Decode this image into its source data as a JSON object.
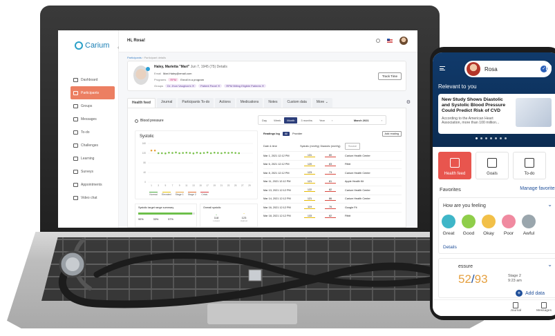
{
  "web": {
    "brand": "Carium",
    "greeting": "Hi, Rosa!",
    "nav": [
      "Dashboard",
      "Participants",
      "Groups",
      "Messages",
      "To-do",
      "Challenges",
      "Learning",
      "Surveys",
      "Appointments",
      "Video chat"
    ],
    "active_nav": "Participants",
    "breadcrumbs": [
      "Participants",
      "Participant details"
    ],
    "profile": {
      "name": "Haley, Marietta \"Mari\"",
      "dob": "Jun 7, 1945 (75)",
      "details_link": "Details",
      "email_label": "Email",
      "email": "Mari.Haley@email.com",
      "programs_label": "Programs",
      "program_chip": "RPM",
      "program_status": "Enroll in a program",
      "groups_label": "Groups",
      "group_chips": [
        "Dr. Jhon Vaughan's ✕",
        "Patient Panel ✕",
        "RPM Billing Eligible Patients ✕"
      ],
      "track_time": "Track Time"
    },
    "tabs": [
      "Health feed",
      "Journal",
      "Participants To-do",
      "Actions",
      "Medications",
      "Notes",
      "Custom data",
      "More ⌄"
    ],
    "active_tab": "Health feed",
    "metric_title": "Blood pressure",
    "ranges": [
      "Day",
      "Week",
      "Month",
      "3 months",
      "Year"
    ],
    "active_range": "Month",
    "month": "March 2021",
    "chart_title": "Systolic",
    "legend": [
      "Normal",
      "Elevated",
      "Stage 1",
      "Stage 2",
      "Crisis"
    ],
    "legend_colors": [
      "#46a83a",
      "#e6c200",
      "#e6a23c",
      "#e26a2c",
      "#d9383c"
    ],
    "summary_title": "Systolic target range summary",
    "summary_pcts": [
      "90%",
      "33%",
      "57%"
    ],
    "overall_title": "Overall systolic",
    "overall": [
      {
        "value": "118",
        "label": "Lowest"
      },
      {
        "value": "123",
        "label": "Highest"
      }
    ],
    "log": {
      "title": "Readings log",
      "filters": [
        "All",
        "Provider"
      ],
      "add": "Add reading",
      "cols": [
        "Date & time",
        "Systolic (mmHg)",
        "Diastolic (mmHg)"
      ],
      "source_placeholder": "Source",
      "rows": [
        [
          "Mar 1, 2021 12:12 PM",
          "131",
          "80",
          "Carium Health Center"
        ],
        [
          "Mar 6, 2021 12:12 PM",
          "120",
          "83",
          "Fitbit"
        ],
        [
          "Mar 8, 2021 12:12 PM",
          "123",
          "73",
          "Carium Health Center"
        ],
        [
          "Mar 11, 2021 12:12 PM",
          "121",
          "81",
          "Apple Health Kit"
        ],
        [
          "Mar 13, 2021 12:12 PM",
          "122",
          "82",
          "Carium Health Center"
        ],
        [
          "Mar 14, 2021 12:12 PM",
          "121",
          "86",
          "Carium Health Center"
        ],
        [
          "Mar 16, 2021 12:12 PM",
          "119",
          "76",
          "Google Fit"
        ],
        [
          "Mar 18, 2021 12:12 PM",
          "133",
          "82",
          "Fitbit"
        ]
      ]
    }
  },
  "chart_data": {
    "type": "scatter",
    "title": "Systolic",
    "x": [
      1,
      2,
      3,
      4,
      5,
      6,
      7,
      8,
      9,
      10,
      11,
      12,
      13,
      14,
      15,
      16,
      17,
      18,
      19,
      20,
      21,
      22,
      23,
      24,
      25,
      26
    ],
    "values": [
      131,
      131,
      120,
      120,
      119,
      122,
      121,
      123,
      120,
      121,
      122,
      121,
      119,
      122,
      120,
      121,
      123,
      120,
      122,
      121,
      120,
      122,
      121,
      122,
      121,
      120
    ],
    "series_colors": [
      "#e6a23c",
      "#e6a23c",
      "#79c14a",
      "#79c14a",
      "#79c14a",
      "#79c14a",
      "#79c14a",
      "#79c14a",
      "#79c14a",
      "#79c14a",
      "#79c14a",
      "#79c14a",
      "#79c14a",
      "#79c14a",
      "#79c14a",
      "#79c14a",
      "#79c14a",
      "#79c14a",
      "#79c14a",
      "#79c14a",
      "#79c14a",
      "#79c14a",
      "#79c14a",
      "#79c14a",
      "#79c14a",
      "#79c14a"
    ],
    "y_ticks": [
      160,
      120,
      80,
      40,
      0
    ],
    "x_ticks": [
      1,
      3,
      5,
      7,
      9,
      11,
      13,
      15,
      17,
      19,
      21,
      23,
      25,
      27,
      29
    ],
    "ylim": [
      0,
      160
    ],
    "xlim": [
      0,
      30
    ],
    "grid": true
  },
  "phone": {
    "user": "Rosa",
    "section": "Relevant to you",
    "article_title": "New Study Shows Diastolic and Systolic Blood Pressure Could Predict Risk of CVD",
    "article_desc": "According to the American Heart Association, more than 100 million...",
    "tiles": [
      "Health feed",
      "Goals",
      "To-do"
    ],
    "favorites": "Favorites",
    "manage_favorites": "Manage favorites",
    "feeling_question": "How are you feeling",
    "moods": [
      "Great",
      "Good",
      "Okay",
      "Poor",
      "Awful"
    ],
    "mood_colors": [
      "#3fb6c8",
      "#8fce4a",
      "#f2c048",
      "#f08aa0",
      "#9aa6ad"
    ],
    "details": "Details",
    "bp_label": "essure",
    "bp_sys": "52",
    "bp_sep": "/",
    "bp_dia": "93",
    "bp_stage": "Stage 2",
    "bp_time": "9:23 am",
    "add_data": "Add data",
    "bottom_nav": [
      "Journal",
      "Messages"
    ]
  }
}
